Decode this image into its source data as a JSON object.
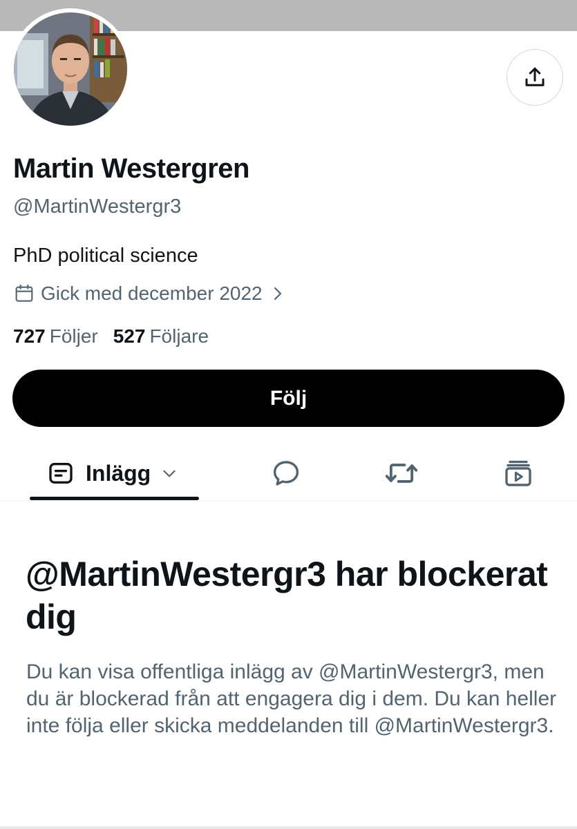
{
  "profile": {
    "display_name": "Martin Westergren",
    "handle": "@MartinWestergr3",
    "bio": "PhD political science",
    "joined": "Gick med december 2022",
    "following_count": "727",
    "following_label": "Följer",
    "followers_count": "527",
    "followers_label": "Följare"
  },
  "actions": {
    "follow_label": "Följ"
  },
  "tabs": {
    "posts_label": "Inlägg"
  },
  "blocked": {
    "title": "@MartinWestergr3 har blockerat dig",
    "description": "Du kan visa offentliga inlägg av @MartinWestergr3, men du är blockerad från att engagera dig i dem. Du kan heller inte följa eller skicka meddelanden till @MartinWestergr3."
  },
  "icons": {
    "share": "share-icon",
    "calendar": "calendar-icon",
    "chevron": "chevron-right-icon",
    "posts": "posts-icon",
    "dropdown": "chevron-down-icon",
    "replies": "speech-bubble-icon",
    "reposts": "repost-icon",
    "media": "media-icon"
  },
  "colors": {
    "text": "#0f1419",
    "secondary_text": "#536471",
    "follow_button": "#000000",
    "banner": "#b8b8b8"
  }
}
